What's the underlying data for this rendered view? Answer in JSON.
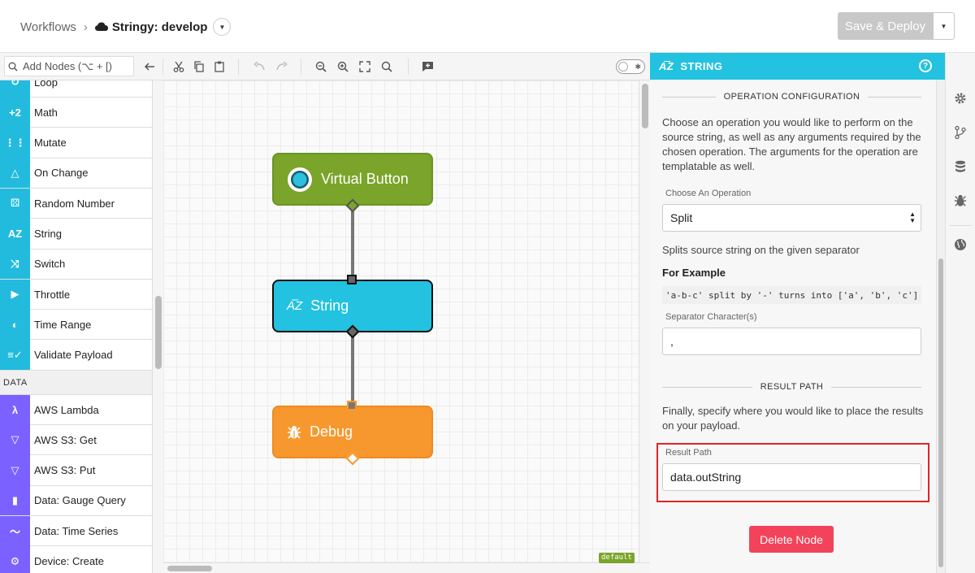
{
  "header": {
    "breadcrumb_root": "Workflows",
    "breadcrumb_separator": "›",
    "app_name": "Stringy: develop",
    "save_label": "Save & Deploy"
  },
  "toolbar": {
    "search_placeholder": "Add Nodes (⌥ + [)",
    "icons": [
      "back-arrow-icon",
      "cut-icon",
      "copy-icon",
      "paste-icon",
      "undo-icon",
      "redo-icon",
      "zoom-out-icon",
      "zoom-in-icon",
      "fit-icon",
      "search-icon",
      "comment-icon"
    ]
  },
  "palette": {
    "items_top": [
      {
        "label": "Loop",
        "icon": "loop-icon",
        "glyph": "↻"
      },
      {
        "label": "Math",
        "icon": "math-icon",
        "glyph": "+2"
      },
      {
        "label": "Mutate",
        "icon": "mutate-icon",
        "glyph": "⋮⋮"
      },
      {
        "label": "On Change",
        "icon": "triangle-icon",
        "glyph": "△"
      },
      {
        "label": "Random Number",
        "icon": "dice-icon",
        "glyph": "⚄"
      },
      {
        "label": "String",
        "icon": "az-icon",
        "glyph": "AZ"
      },
      {
        "label": "Switch",
        "icon": "shuffle-icon",
        "glyph": "⤨"
      },
      {
        "label": "Throttle",
        "icon": "throttle-icon",
        "glyph": "▶"
      },
      {
        "label": "Time Range",
        "icon": "clock-icon",
        "glyph": "◐"
      },
      {
        "label": "Validate Payload",
        "icon": "checklist-icon",
        "glyph": "≡✓"
      }
    ],
    "section_label": "DATA",
    "items_data": [
      {
        "label": "AWS Lambda",
        "icon": "lambda-icon",
        "glyph": "λ"
      },
      {
        "label": "AWS S3: Get",
        "icon": "bucket-icon",
        "glyph": "▽"
      },
      {
        "label": "AWS S3: Put",
        "icon": "bucket-icon",
        "glyph": "▽"
      },
      {
        "label": "Data: Gauge Query",
        "icon": "bar-chart-icon",
        "glyph": "▮"
      },
      {
        "label": "Data: Time Series",
        "icon": "line-chart-icon",
        "glyph": "〜"
      },
      {
        "label": "Device: Create",
        "icon": "device-icon",
        "glyph": "⚙"
      }
    ]
  },
  "canvas": {
    "nodes": [
      {
        "label": "Virtual Button"
      },
      {
        "label": "String"
      },
      {
        "label": "Debug"
      }
    ],
    "flow_tag": "default"
  },
  "panel": {
    "title": "STRING",
    "section1": "OPERATION CONFIGURATION",
    "intro": "Choose an operation you would like to perform on the source string, as well as any arguments required by the chosen operation. The arguments for the operation are templatable as well.",
    "operation_label": "Choose An Operation",
    "operation_value": "Split",
    "operation_desc": "Splits source string on the given separator",
    "example_heading": "For Example",
    "example_code": "'a-b-c' split by '-' turns into ['a', 'b', 'c']",
    "separator_label": "Separator Character(s)",
    "separator_value": ",",
    "section2": "RESULT PATH",
    "result_intro": "Finally, specify where you would like to place the results on your payload.",
    "result_label": "Result Path",
    "result_value": "data.outString",
    "delete_label": "Delete Node"
  },
  "colors": {
    "accent": "#22c2e0",
    "virtual_button": "#7aa42a",
    "string_node": "#22c2e0",
    "debug_node": "#f7982e",
    "delete": "#f2435a",
    "highlight": "#e02424"
  },
  "rail_icons": [
    "gear-icon",
    "branch-icon",
    "database-icon",
    "bug-icon",
    "globe-icon"
  ]
}
